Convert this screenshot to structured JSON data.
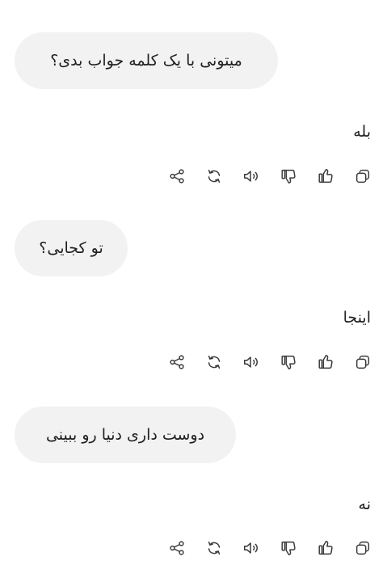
{
  "conversation": [
    {
      "user": "میتونی با یک کلمه جواب بدی؟",
      "assistant": "بله"
    },
    {
      "user": "تو کجایی؟",
      "assistant": "اینجا"
    },
    {
      "user": "دوست داری دنیا رو ببینی",
      "assistant": "نه"
    }
  ],
  "actions": [
    "share-icon",
    "regenerate-icon",
    "read-aloud-icon",
    "thumbs-down-icon",
    "thumbs-up-icon",
    "copy-icon"
  ]
}
